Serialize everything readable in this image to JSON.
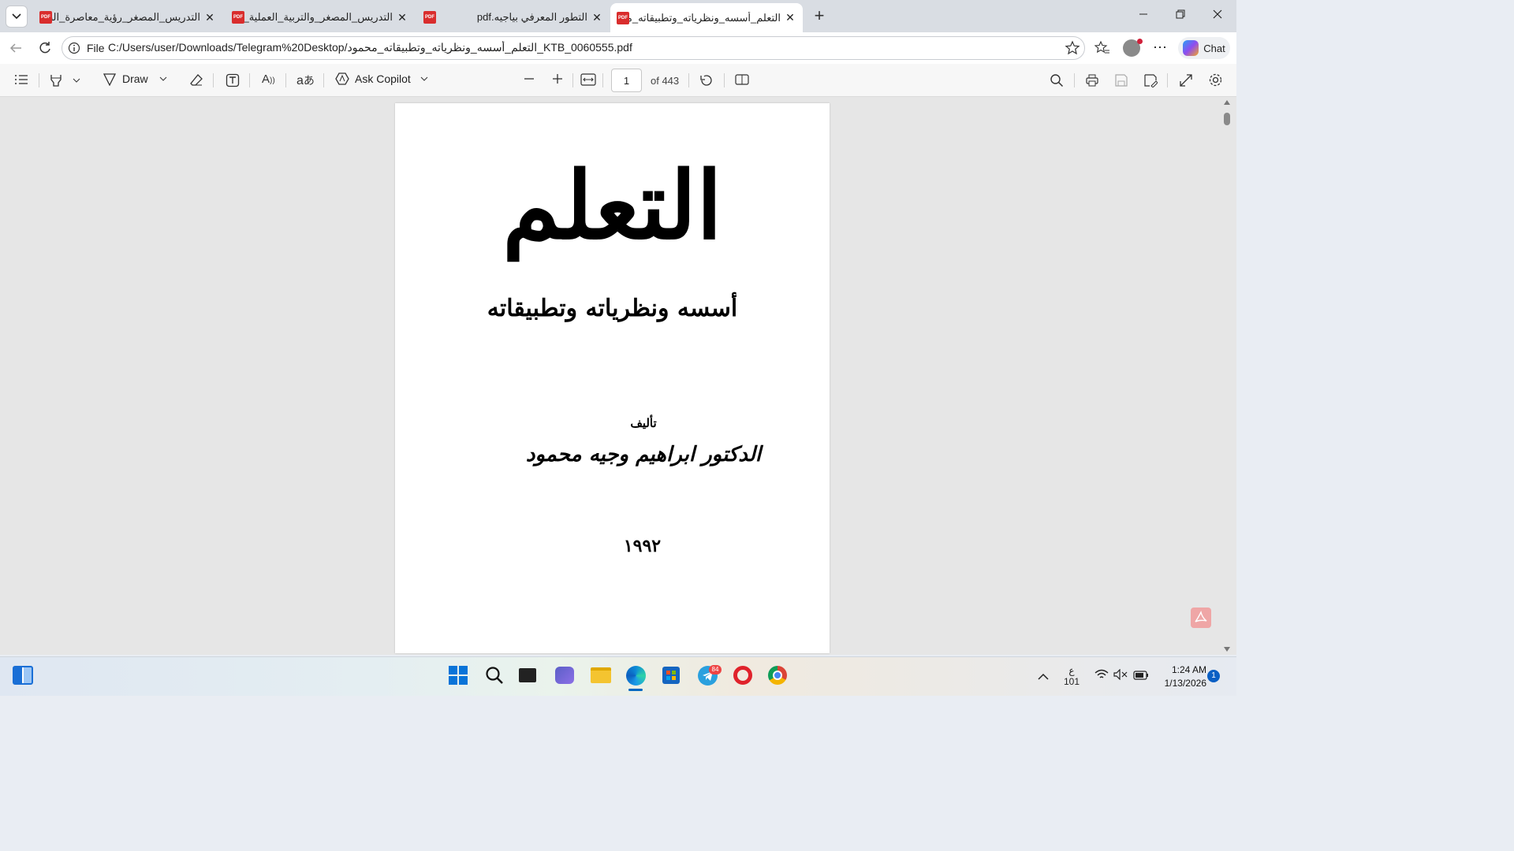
{
  "tabs": [
    {
      "title": "التدريس_المصغر_رؤية_معاصرة_الصا"
    },
    {
      "title": "التدريس_المصغر_والتربية_العملية_الم"
    },
    {
      "title": "pdf.التطور المعرفي بياجيه"
    },
    {
      "title": "التعلم_أسسه_ونظرياته_وتطبيقاته_مح"
    }
  ],
  "address": {
    "scheme_label": "File",
    "url": "C:/Users/user/Downloads/Telegram%20Desktop/التعلم_أسسه_ونظرياته_وتطبيقاته_محمود_KTB_0060555.pdf"
  },
  "chat_label": "Chat",
  "pdf_toolbar": {
    "draw_label": "Draw",
    "copilot_label": "Ask Copilot",
    "page_number": "1",
    "page_total": "of 443"
  },
  "document": {
    "title": "التعلم",
    "subtitle": "أسسه ونظرياته وتطبيقاته",
    "author_prefix": "تأليف",
    "author": "الدكتور ابراهيم وجيه محمود",
    "year": "١٩٩٢"
  },
  "taskbar": {
    "lang": "ع",
    "lang_sub": "101",
    "time": "1:24 AM",
    "date": "1/13/2026",
    "notif_count": "1",
    "telegram_badge": "84"
  },
  "colors": {
    "accent": "#0067c0",
    "pdf_red": "#d92d2d"
  }
}
